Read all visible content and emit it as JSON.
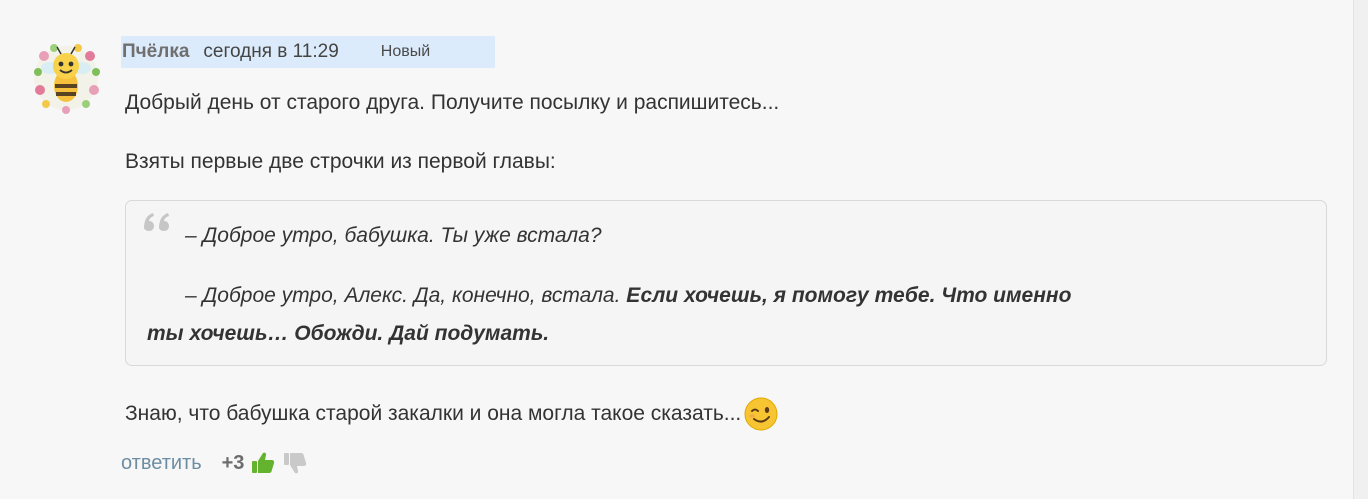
{
  "comment": {
    "author": "Пчёлка",
    "date": "сегодня в 11:29",
    "badge": "Новый",
    "avatar_icon": "bee-avatar-icon",
    "paragraph1": "Добрый день от старого друга. Получите посылку и распишитесь...",
    "paragraph2": "Взяты первые две строчки из первой главы:",
    "quote": {
      "icon": "quote-mark-icon",
      "line1": "– Доброе утро, бабушка. Ты уже встала?",
      "line2_regular": "– Доброе утро, Алекс. Да, конечно, встала.",
      "line2_bold": "Если хочешь, я помогу тебе. Что именно",
      "line3_bold": "ты хочешь… Обожди. Дай подумать."
    },
    "paragraph3": "Знаю, что бабушка старой закалки и она могла такое сказать...",
    "emoji": "wink-emoji-icon"
  },
  "actions": {
    "reply_label": "ответить",
    "score": "+3",
    "like_icon": "thumbs-up-icon",
    "dislike_icon": "thumbs-down-icon",
    "like_color": "#63b32e",
    "dislike_color": "#c9c9c9"
  },
  "colors": {
    "meta_highlight": "#dcebfb",
    "link": "#6d8da3"
  }
}
